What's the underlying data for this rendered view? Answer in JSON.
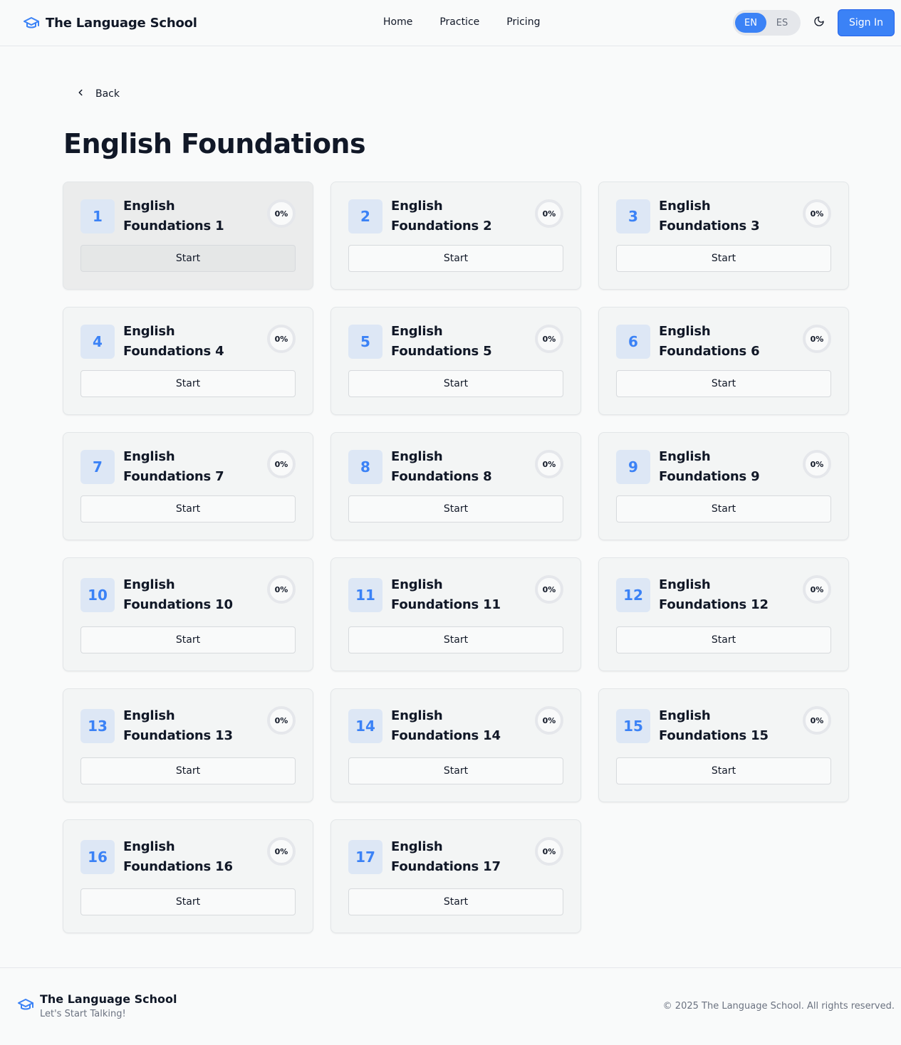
{
  "header": {
    "brand": "The Language School",
    "nav": [
      "Home",
      "Practice",
      "Pricing"
    ],
    "lang_en": "EN",
    "lang_es": "ES",
    "sign_in": "Sign In"
  },
  "page": {
    "back": "Back",
    "title": "English Foundations"
  },
  "lessons": [
    {
      "num": "1",
      "title": "English Foundations 1",
      "progress": "0%",
      "start": "Start"
    },
    {
      "num": "2",
      "title": "English Foundations 2",
      "progress": "0%",
      "start": "Start"
    },
    {
      "num": "3",
      "title": "English Foundations 3",
      "progress": "0%",
      "start": "Start"
    },
    {
      "num": "4",
      "title": "English Foundations 4",
      "progress": "0%",
      "start": "Start"
    },
    {
      "num": "5",
      "title": "English Foundations 5",
      "progress": "0%",
      "start": "Start"
    },
    {
      "num": "6",
      "title": "English Foundations 6",
      "progress": "0%",
      "start": "Start"
    },
    {
      "num": "7",
      "title": "English Foundations 7",
      "progress": "0%",
      "start": "Start"
    },
    {
      "num": "8",
      "title": "English Foundations 8",
      "progress": "0%",
      "start": "Start"
    },
    {
      "num": "9",
      "title": "English Foundations 9",
      "progress": "0%",
      "start": "Start"
    },
    {
      "num": "10",
      "title": "English Foundations 10",
      "progress": "0%",
      "start": "Start"
    },
    {
      "num": "11",
      "title": "English Foundations 11",
      "progress": "0%",
      "start": "Start"
    },
    {
      "num": "12",
      "title": "English Foundations 12",
      "progress": "0%",
      "start": "Start"
    },
    {
      "num": "13",
      "title": "English Foundations 13",
      "progress": "0%",
      "start": "Start"
    },
    {
      "num": "14",
      "title": "English Foundations 14",
      "progress": "0%",
      "start": "Start"
    },
    {
      "num": "15",
      "title": "English Foundations 15",
      "progress": "0%",
      "start": "Start"
    },
    {
      "num": "16",
      "title": "English Foundations 16",
      "progress": "0%",
      "start": "Start"
    },
    {
      "num": "17",
      "title": "English Foundations 17",
      "progress": "0%",
      "start": "Start"
    }
  ],
  "footer": {
    "brand": "The Language School",
    "tagline": "Let's Start Talking!",
    "copyright": "© 2025 The Language School. All rights reserved."
  },
  "colors": {
    "accent": "#3b82f6",
    "badge_bg": "#dde7f5"
  },
  "icons": {
    "brand": "graduation-cap-icon",
    "theme": "moon-icon",
    "back": "chevron-left-icon"
  }
}
